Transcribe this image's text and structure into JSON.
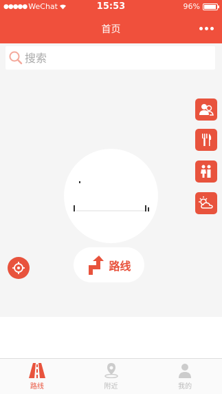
{
  "status_bar": {
    "signal_dots": "●●●●●",
    "carrier": "WeChat",
    "time": "15:53",
    "battery": "96%",
    "battery_level": 0.96
  },
  "navbar": {
    "title": "首页",
    "more_icon": "more-dots-icon"
  },
  "search": {
    "placeholder": "搜索",
    "value": ""
  },
  "side_buttons": [
    {
      "name": "nearby-people",
      "icon": "people-icon"
    },
    {
      "name": "restaurant",
      "icon": "fork-knife-icon"
    },
    {
      "name": "restroom",
      "icon": "restroom-icon"
    },
    {
      "name": "weather",
      "icon": "weather-icon"
    }
  ],
  "route_button": {
    "label": "路线",
    "icon": "route-arrow-icon"
  },
  "tabbar": {
    "tabs": [
      {
        "label": "路线",
        "icon": "road-icon",
        "active": true
      },
      {
        "label": "附近",
        "icon": "location-pin-icon",
        "active": false
      },
      {
        "label": "我的",
        "icon": "person-icon",
        "active": false
      }
    ]
  },
  "colors": {
    "accent": "#f0503c",
    "button": "#e8533d",
    "map_bg": "#f5f5f5",
    "inactive": "#bbbbbb"
  }
}
